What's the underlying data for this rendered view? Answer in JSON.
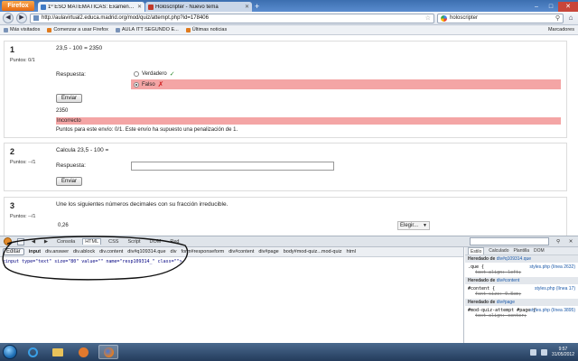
{
  "browser": {
    "app_button": "Firefox",
    "tabs": [
      {
        "title": "1º ESO MATEMÁTICAS: Examen de d...",
        "active": true
      },
      {
        "title": "Holoscripter - Nuevo tema",
        "active": false
      }
    ],
    "url": "http://aulavirtual2.educa.madrid.org/mod/quiz/attempt.php?id=178406",
    "search_text": "holoscripter",
    "bookmarks": [
      "Más visitados",
      "Comenzar a usar Firefox",
      "AULA ITT SEGUNDO E...",
      "Últimas noticias"
    ],
    "bookmarks_right": "Marcadores"
  },
  "quiz": {
    "q1": {
      "number": "1",
      "points": "Puntos: 0/1",
      "text": "23,5 - 100 = 2350",
      "answer_label": "Respuesta:",
      "option_true": "Verdadero",
      "option_false": "Falso",
      "submit_label": "Enviar",
      "feedback_value": "2350",
      "status": "Incorrecto",
      "points_text": "Puntos para este envío: 0/1. Este envío ha supuesto una penalización de 1."
    },
    "q2": {
      "number": "2",
      "points": "Puntos: --/1",
      "text": "Calcula 23,5 - 100 =",
      "answer_label": "Respuesta:",
      "submit_label": "Enviar"
    },
    "q3": {
      "number": "3",
      "points": "Puntos: --/1",
      "text": "Une los siguientes números decimales con su fracción irreducible.",
      "row_value": "0,26",
      "select_label": "Elegir..."
    }
  },
  "firebug": {
    "tabs": [
      "Consola",
      "HTML",
      "CSS",
      "Script",
      "DOM",
      "Red"
    ],
    "active_tab": "HTML",
    "edit_label": "Editar",
    "breadcrumbs": [
      "input",
      "div.answer",
      "div.ablock",
      "div.content",
      "div#q109314.que",
      "div",
      "form#responseform",
      "div#content",
      "div#page",
      "body#mod-quiz...mod-quiz",
      "html"
    ],
    "source": "<input type=\"text\" size=\"80\" value=\"\" name=\"resp109314_\" class=\"\">",
    "side_tabs": [
      "Estilo",
      "Calculado",
      "Plantilla",
      "DOM"
    ],
    "active_side_tab": "Estilo",
    "rules": [
      {
        "heading": "Heredado de",
        "selector": "div#q109314.que",
        "rule": ".que {",
        "source": "styles.php (línea 2632)",
        "prop": "text-align: left;"
      },
      {
        "heading": "Heredado de",
        "selector": "div#content",
        "rule": "#content {",
        "source": "styles.php (línea 17)",
        "prop": "font-size: 0.8em;"
      },
      {
        "heading": "Heredado de",
        "selector": "div#page",
        "rule": "#mod-quiz-attempt #page {",
        "source": "styles.php (línea 3895)",
        "prop": "text-align: center;"
      }
    ]
  },
  "taskbar": {
    "time": "9:57",
    "date": "31/05/2012"
  }
}
